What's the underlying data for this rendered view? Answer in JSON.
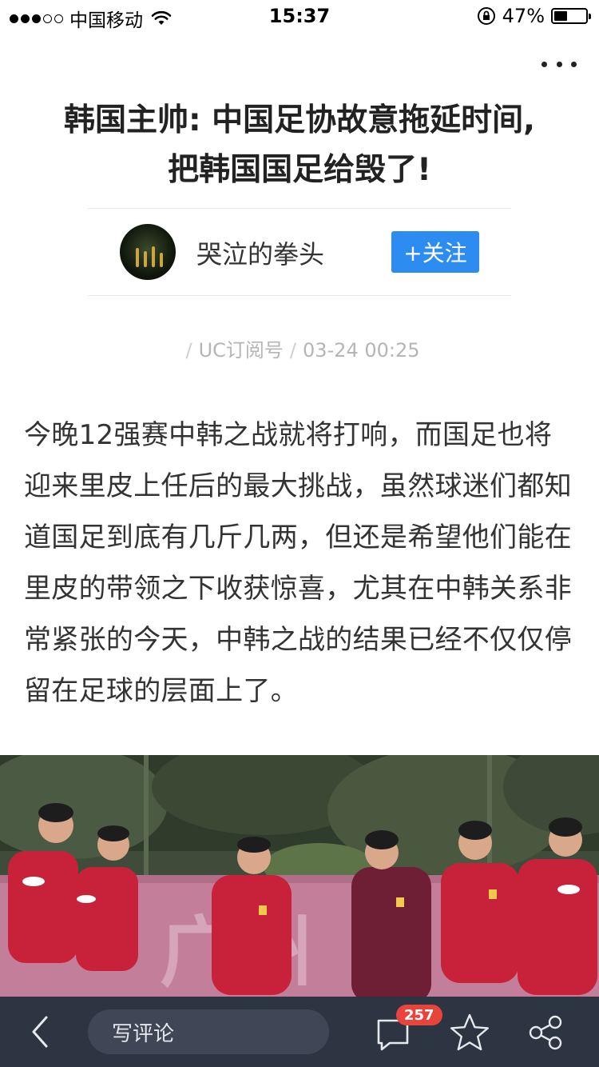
{
  "status_bar": {
    "carrier": "中国移动",
    "time": "15:37",
    "battery_percent_text": "47%",
    "battery_level": 0.47,
    "signal_bars_filled": 3,
    "signal_bars_total": 5
  },
  "article": {
    "title": "韩国主帅: 中国足协故意拖延时间, 把韩国国足给毁了!",
    "author": {
      "name": "哭泣的拳头",
      "follow_label": "+关注"
    },
    "source": "UC订阅号",
    "datetime": "03-24 00:25",
    "body": "今晚12强赛中韩之战就将打响，而国足也将迎来里皮上任后的最大挑战，虽然球迷们都知道国足到底有几斤几两，但还是希望他们能在里皮的带领之下收获惊喜，尤其在中韩关系非常紧张的今天，中韩之战的结果已经不仅仅停留在足球的层面上了。"
  },
  "bottom_bar": {
    "comment_placeholder": "写评论",
    "comment_count": "257"
  },
  "colors": {
    "accent": "#2d8cf0",
    "bottom_bar_bg": "#2e3542",
    "badge": "#e9443c"
  },
  "icons": [
    "signal-dots-icon",
    "wifi-icon",
    "rotation-lock-icon",
    "battery-icon",
    "more-icon",
    "back-icon",
    "comment-icon",
    "star-icon",
    "share-icon"
  ]
}
